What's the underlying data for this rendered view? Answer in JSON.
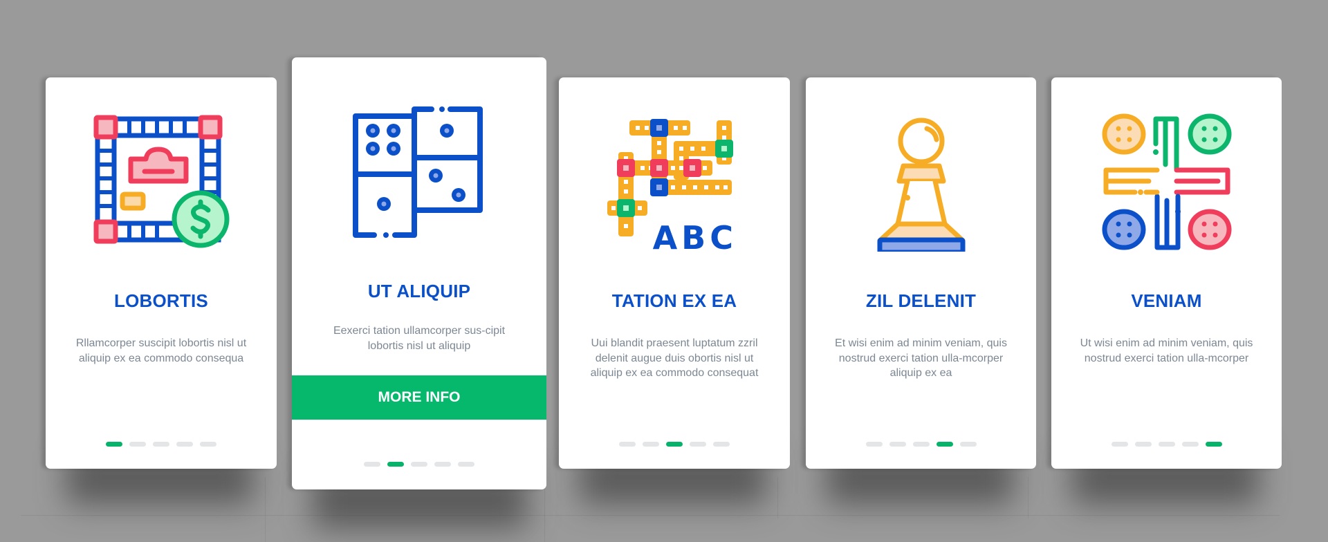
{
  "palette": {
    "background": "#9a9a9a",
    "card": "#ffffff",
    "title": "#0b50c8",
    "body_text": "#7c8794",
    "accent_green": "#05b86b",
    "dot_inactive": "#e3e5e7",
    "icon_blue": "#0b50c8",
    "icon_red": "#ef3d5b",
    "icon_orange": "#f6ad25",
    "icon_green": "#0bb56c"
  },
  "cards": [
    {
      "icon": "board-game-money-icon",
      "title": "LOBORTIS",
      "description": "Rllamcorper suscipit lobortis nisl ut aliquip ex ea commodo consequa",
      "active_page": 1,
      "page_count": 5
    },
    {
      "icon": "dominoes-icon",
      "title": "UT ALIQUIP",
      "description": "Eexerci tation ullamcorper sus-cipit lobortis nisl ut aliquip",
      "button_label": "MORE INFO",
      "active_page": 2,
      "page_count": 5
    },
    {
      "icon": "crossword-abc-icon",
      "title": "TATION EX EA",
      "description": "Uui blandit praesent luptatum zzril delenit augue duis obortis nisl ut aliquip ex ea commodo consequat",
      "icon_text": "ABC",
      "active_page": 3,
      "page_count": 5
    },
    {
      "icon": "chess-pawn-icon",
      "title": "ZIL DELENIT",
      "description": "Et wisi enim ad minim veniam, quis nostrud exerci tation ulla-mcorper aliquip ex ea",
      "active_page": 4,
      "page_count": 5
    },
    {
      "icon": "ludo-board-icon",
      "title": "VENIAM",
      "description": "Ut wisi enim ad minim veniam, quis nostrud exerci tation ulla-mcorper",
      "active_page": 5,
      "page_count": 5
    }
  ]
}
